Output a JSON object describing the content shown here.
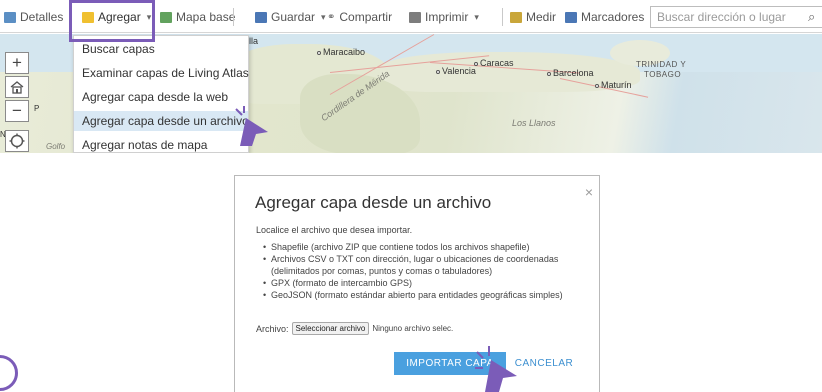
{
  "toolbar": {
    "details": "Detalles",
    "add": "Agregar",
    "basemap": "Mapa base",
    "save": "Guardar",
    "share": "Compartir",
    "print": "Imprimir",
    "measure": "Medir",
    "bookmarks": "Marcadores",
    "search_placeholder": "Buscar dirección o lugar"
  },
  "add_menu": {
    "items": [
      "Buscar capas",
      "Examinar capas de Living Atlas",
      "Agregar capa desde la web",
      "Agregar capa desde un archivo",
      "Agregar notas de mapa"
    ],
    "selected_index": 3
  },
  "map": {
    "labels": {
      "maracaibo": "Maracaibo",
      "caracas": "Caracas",
      "valencia": "Valencia",
      "barcelona": "Barcelona",
      "maturin": "Maturín",
      "trinidad": "TRINIDAD Y",
      "tobago": "TOBAGO",
      "cordillera": "Cordillera de Mérida",
      "llanos": "Los Llanos",
      "barranquilla": "nquilla",
      "golfo": "Golfo",
      "na": "NA",
      "p": "P"
    },
    "controls": {
      "zoom_in": "+",
      "zoom_out": "−"
    }
  },
  "dialog": {
    "title": "Agregar capa desde un archivo",
    "intro": "Localice el archivo que desea importar.",
    "formats": [
      "Shapefile (archivo ZIP que contiene todos los archivos shapefile)",
      "Archivos CSV o TXT con dirección, lugar o ubicaciones de coordenadas (delimitados por comas, puntos y comas o tabuladores)",
      "GPX (formato de intercambio GPS)",
      "GeoJSON (formato estándar abierto para entidades geográficas simples)"
    ],
    "file_label": "Archivo:",
    "file_button": "Seleccionar archivo",
    "file_status": "Ninguno archivo selec.",
    "import_button": "IMPORTAR CAPA",
    "cancel_button": "CANCELAR",
    "close_symbol": "×"
  },
  "colors": {
    "highlight": "#7b5cb8",
    "primary_button": "#4aa0df",
    "link": "#3c8fd0",
    "menu_selected": "#d9e8f4"
  }
}
